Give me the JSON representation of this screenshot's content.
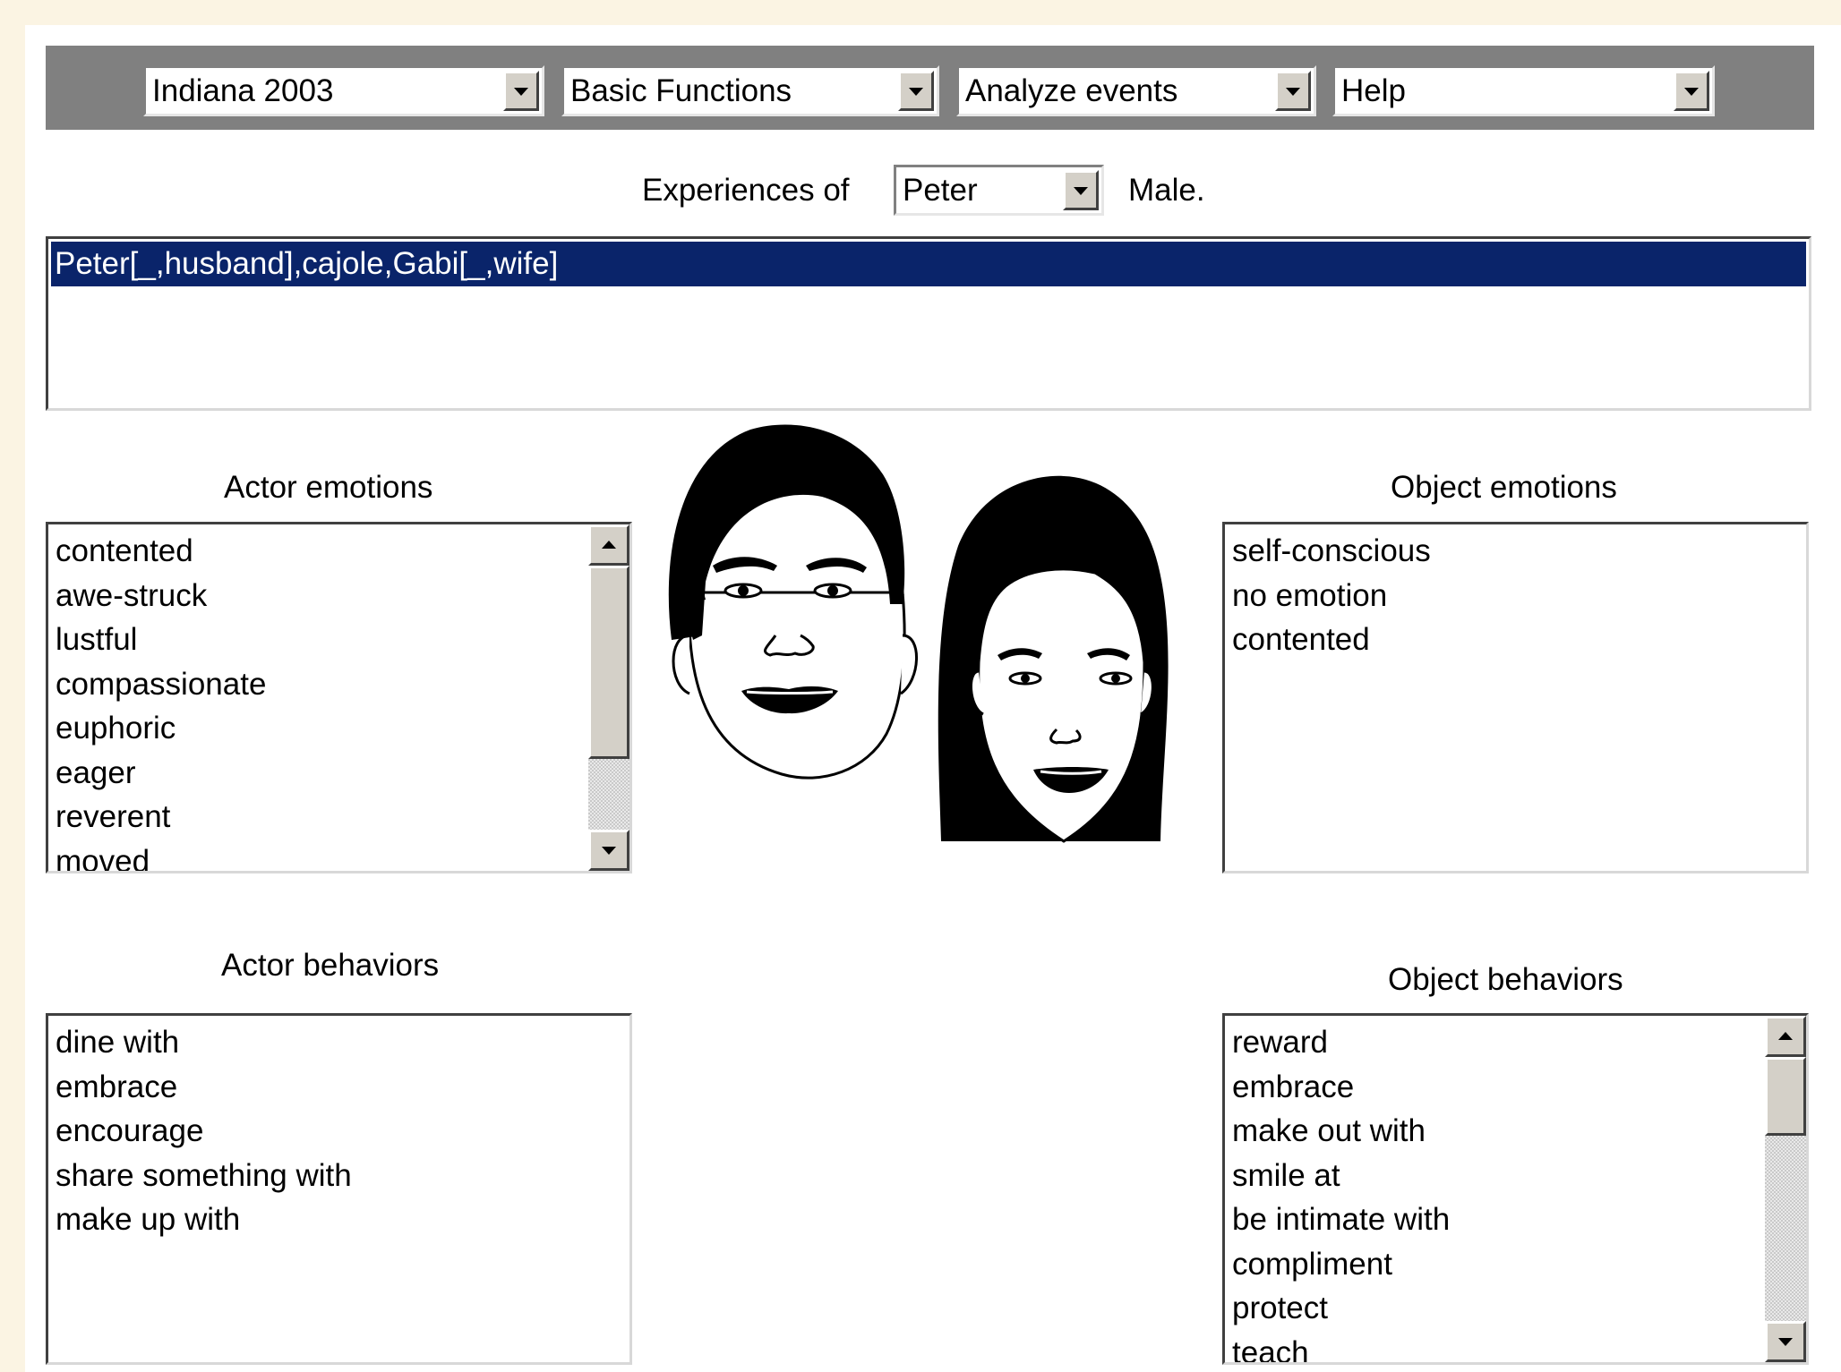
{
  "toolbar": {
    "menus": [
      {
        "value": "Indiana 2003"
      },
      {
        "value": "Basic Functions"
      },
      {
        "value": "Analyze events"
      },
      {
        "value": "Help"
      }
    ]
  },
  "experiences": {
    "label": "Experiences of",
    "person": "Peter",
    "gender_label": "Male."
  },
  "events": {
    "items": [
      {
        "text": "Peter[_,husband],cajole,Gabi[_,wife]",
        "selected": true
      }
    ]
  },
  "actor_emotions": {
    "title": "Actor emotions",
    "items": [
      "contented",
      "awe-struck",
      "lustful",
      "compassionate",
      "euphoric",
      "eager",
      "reverent",
      "moved"
    ]
  },
  "object_emotions": {
    "title": "Object emotions",
    "items": [
      "self-conscious",
      "no emotion",
      "contented"
    ]
  },
  "actor_behaviors": {
    "title": "Actor behaviors",
    "items": [
      "dine with",
      "embrace",
      "encourage",
      "share something with",
      "make up with"
    ]
  },
  "object_behaviors": {
    "title": "Object behaviors",
    "items": [
      "reward",
      "embrace",
      "make out with",
      "smile at",
      "be intimate with",
      "compliment",
      "protect",
      "teach"
    ]
  },
  "colors": {
    "toolbar_bg": "#808080",
    "selection_bg": "#0a246a",
    "page_bg": "#fbf4e3"
  },
  "icons": [
    "male-face-icon",
    "female-face-icon",
    "dropdown-arrow-icon",
    "scroll-up-icon",
    "scroll-down-icon"
  ]
}
